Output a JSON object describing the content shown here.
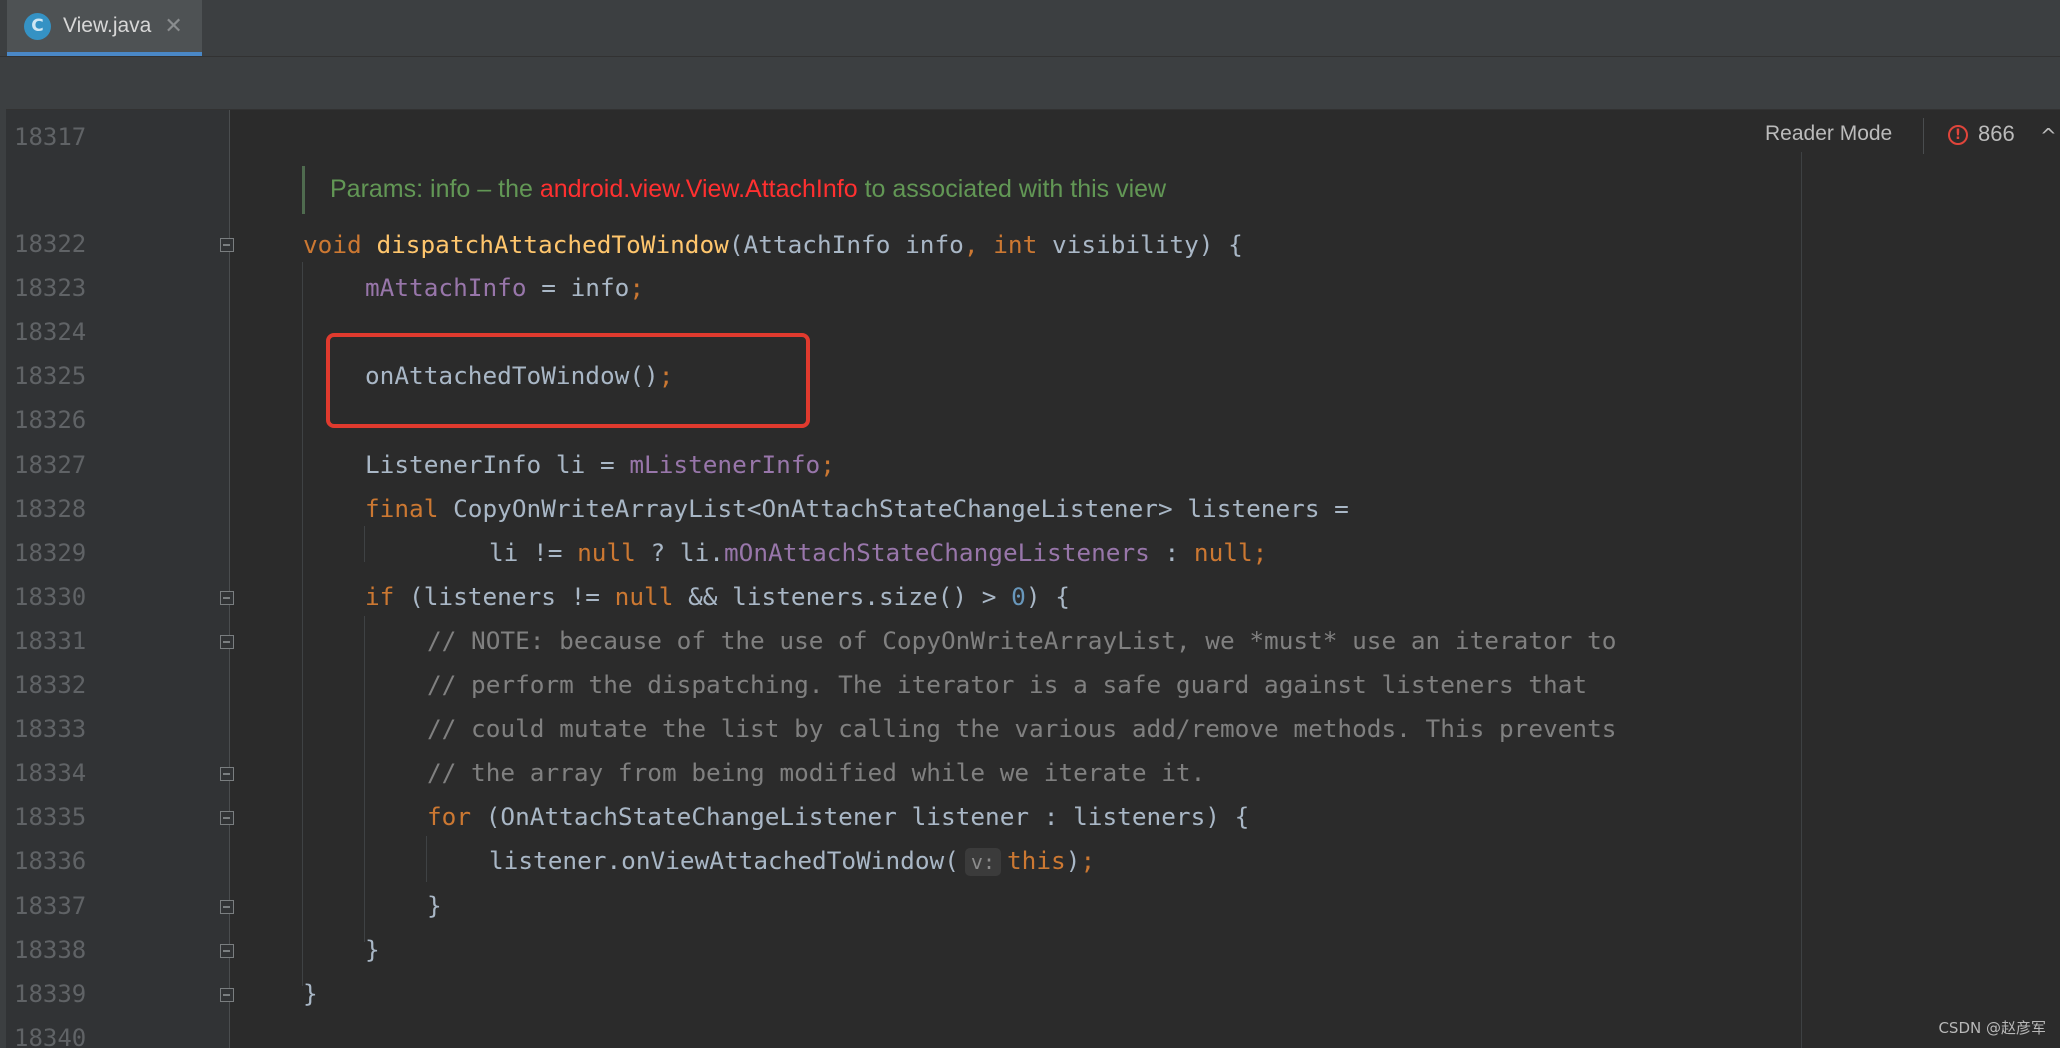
{
  "tab": {
    "icon_letter": "C",
    "label": "View.java",
    "close_glyph": "✕"
  },
  "toolbar": {
    "reader_mode": "Reader Mode",
    "problems_count": "866",
    "error_glyph": "!",
    "nav_up_glyph": "^"
  },
  "doc": {
    "prefix": "Params: info – the ",
    "link": "android.view.View.AttachInfo",
    "suffix": " to associated with this view"
  },
  "line_numbers": [
    "18317",
    "18322",
    "18323",
    "18324",
    "18325",
    "18326",
    "18327",
    "18328",
    "18329",
    "18330",
    "18331",
    "18332",
    "18333",
    "18334",
    "18335",
    "18336",
    "18337",
    "18338",
    "18339",
    "18340"
  ],
  "code": {
    "l18322": {
      "kw": "void",
      "fn": "dispatchAttachedToWindow",
      "a": "(AttachInfo info",
      "comma": ",",
      "kw2": " int",
      "b": " visibility) {"
    },
    "l18323": {
      "fld": "mAttachInfo",
      "a": " = info",
      "semi": ";"
    },
    "l18325": {
      "a": "onAttachedToWindow()",
      "semi": ";"
    },
    "l18327": {
      "a": "ListenerInfo li = ",
      "fld": "mListenerInfo",
      "semi": ";"
    },
    "l18328": {
      "kw": "final",
      "a": " CopyOnWriteArrayList<OnAttachStateChangeListener> listeners ="
    },
    "l18329": {
      "a": "li != ",
      "kw": "null",
      "b": " ? li.",
      "fld": "mOnAttachStateChangeListeners",
      "c": " : ",
      "kw2": "null",
      "semi": ";"
    },
    "l18330": {
      "kw": "if",
      "a": " (listeners != ",
      "kw2": "null",
      "b": " && listeners.size() > ",
      "num": "0",
      "c": ") {"
    },
    "l18331": "// NOTE: because of the use of CopyOnWriteArrayList, we *must* use an iterator to",
    "l18332": "// perform the dispatching. The iterator is a safe guard against listeners that",
    "l18333": "// could mutate the list by calling the various add/remove methods. This prevents",
    "l18334": "// the array from being modified while we iterate it.",
    "l18335": {
      "kw": "for",
      "a": " (OnAttachStateChangeListener listener : listeners) {"
    },
    "l18336": {
      "a": "listener.onViewAttachedToWindow(",
      "hint": "v:",
      "kw": "this",
      "b": ")",
      "semi": ";"
    },
    "l18337": "}",
    "l18338": "}",
    "l18339": "}"
  },
  "watermark": "CSDN @赵彦军",
  "colors": {
    "background": "#2b2b2b",
    "keyword": "#cc7832",
    "method": "#ffc66d",
    "field": "#9876aa",
    "number": "#6897bb",
    "comment": "#808080",
    "doc": "#629755",
    "annotation_box": "#e03a2e",
    "tab_underline": "#4a88c7"
  }
}
